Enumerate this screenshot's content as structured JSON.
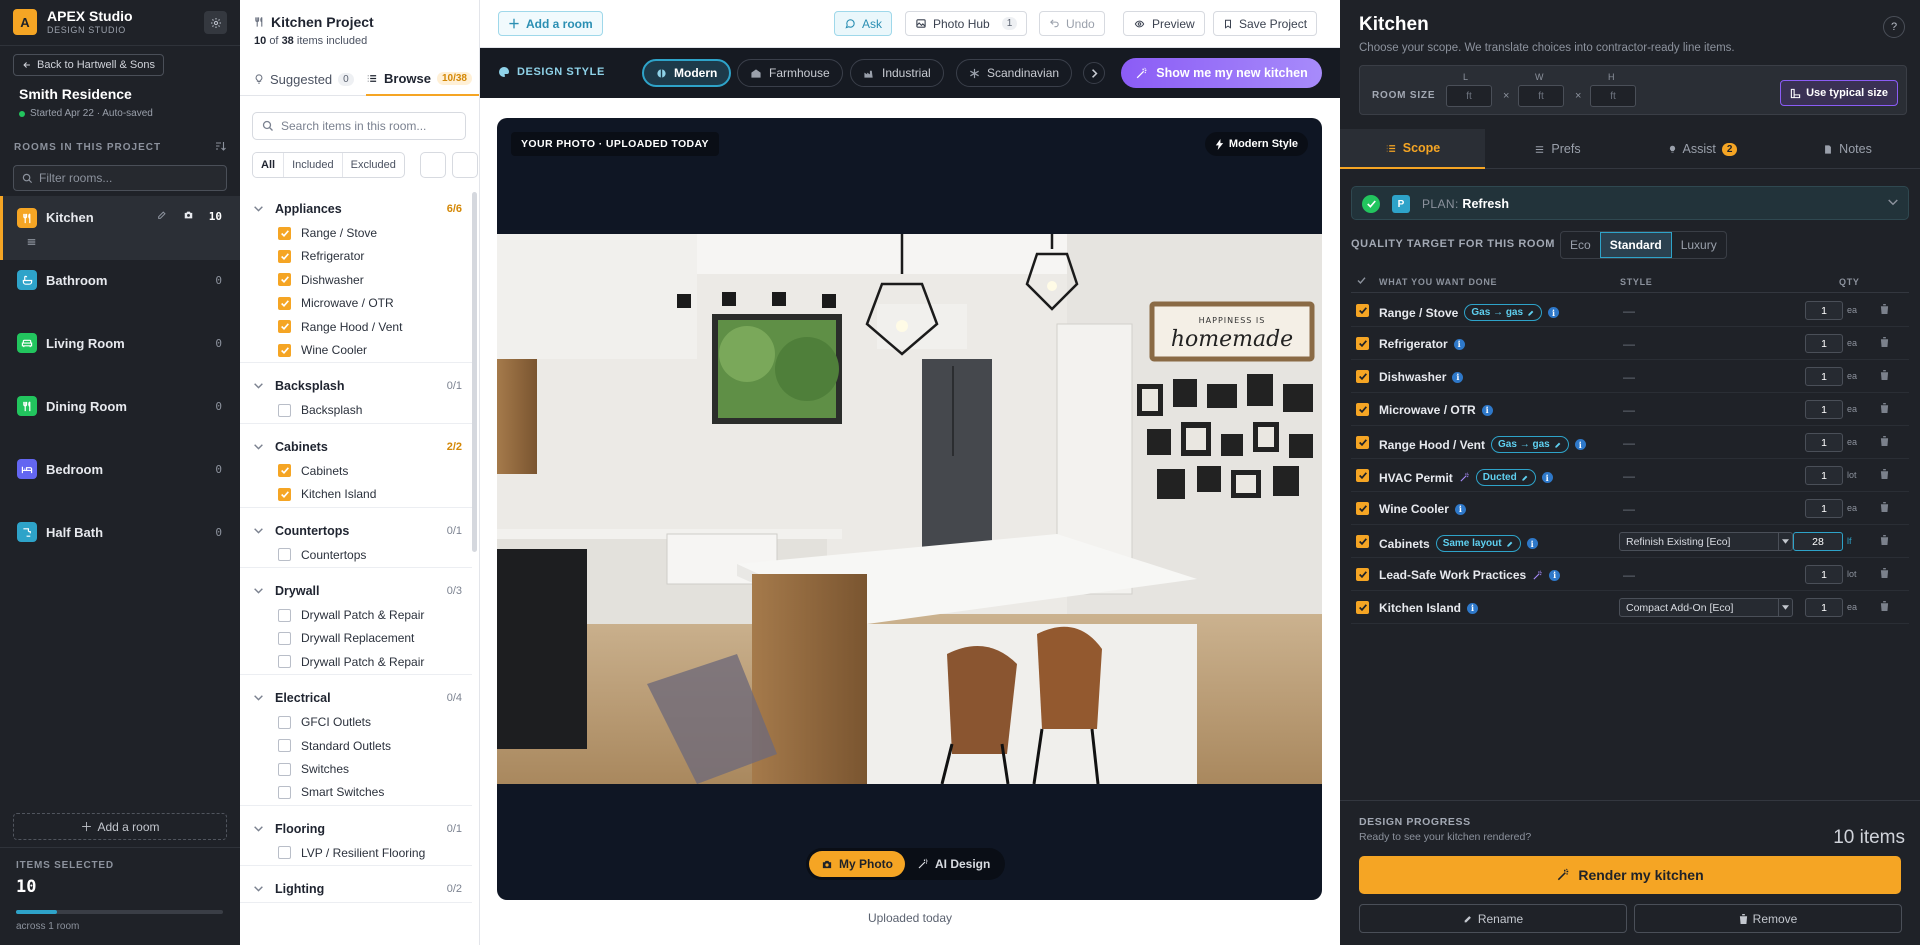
{
  "app": {
    "logo_letter": "A",
    "name": "APEX Studio",
    "subtitle": "DESIGN STUDIO"
  },
  "sidebar": {
    "back_label": "Back to Hartwell & Sons",
    "project_name": "Smith Residence",
    "project_meta": "Started Apr 22 · Auto-saved",
    "rooms_heading": "ROOMS IN THIS PROJECT",
    "filter_placeholder": "Filter rooms...",
    "rooms": [
      {
        "label": "Kitchen",
        "count": "10",
        "color": "#f5a524"
      },
      {
        "label": "Bathroom",
        "count": "0",
        "color": "#2ea3c9"
      },
      {
        "label": "Living Room",
        "count": "0",
        "color": "#22c55e"
      },
      {
        "label": "Dining Room",
        "count": "0",
        "color": "#22c55e"
      },
      {
        "label": "Bedroom",
        "count": "0",
        "color": "#6366f1"
      },
      {
        "label": "Half Bath",
        "count": "0",
        "color": "#2ea3c9"
      }
    ],
    "add_room": "Add a room",
    "items_selected_label": "ITEMS SELECTED",
    "items_selected_count": "10",
    "items_selected_fraction": 0.2,
    "items_selected_sub": "across 1 room"
  },
  "browse": {
    "title": "Kitchen Project",
    "included_count": "10",
    "of_word": "of",
    "total_count": "38",
    "included_suffix": "items included",
    "tab_suggested": "Suggested",
    "tab_suggested_count": "0",
    "tab_browse": "Browse",
    "tab_browse_count": "10/38",
    "search_placeholder": "Search items in this room...",
    "filter_all": "All",
    "filter_included": "Included",
    "filter_excluded": "Excluded",
    "categories": [
      {
        "name": "Appliances",
        "count": "6/6",
        "items": [
          {
            "label": "Range / Stove",
            "checked": true
          },
          {
            "label": "Refrigerator",
            "checked": true
          },
          {
            "label": "Dishwasher",
            "checked": true
          },
          {
            "label": "Microwave / OTR",
            "checked": true
          },
          {
            "label": "Range Hood / Vent",
            "checked": true
          },
          {
            "label": "Wine Cooler",
            "checked": true
          }
        ]
      },
      {
        "name": "Backsplash",
        "count": "0/1",
        "items": [
          {
            "label": "Backsplash",
            "checked": false
          }
        ]
      },
      {
        "name": "Cabinets",
        "count": "2/2",
        "items": [
          {
            "label": "Cabinets",
            "checked": true
          },
          {
            "label": "Kitchen Island",
            "checked": true
          }
        ]
      },
      {
        "name": "Countertops",
        "count": "0/1",
        "items": [
          {
            "label": "Countertops",
            "checked": false
          }
        ]
      },
      {
        "name": "Drywall",
        "count": "0/3",
        "items": [
          {
            "label": "Drywall Patch & Repair",
            "checked": false
          },
          {
            "label": "Drywall Replacement",
            "checked": false
          },
          {
            "label": "Drywall Patch & Repair",
            "checked": false
          }
        ]
      },
      {
        "name": "Electrical",
        "count": "0/4",
        "items": [
          {
            "label": "GFCI Outlets",
            "checked": false
          },
          {
            "label": "Standard Outlets",
            "checked": false
          },
          {
            "label": "Switches",
            "checked": false
          },
          {
            "label": "Smart Switches",
            "checked": false
          }
        ]
      },
      {
        "name": "Flooring",
        "count": "0/1",
        "items": [
          {
            "label": "LVP / Resilient Flooring",
            "checked": false
          }
        ]
      },
      {
        "name": "Lighting",
        "count": "0/2",
        "items": []
      }
    ]
  },
  "toolbar": {
    "add_room": "Add a room",
    "ask": "Ask",
    "photo_hub": "Photo Hub",
    "photo_hub_count": "1",
    "undo": "Undo",
    "preview": "Preview",
    "save": "Save Project"
  },
  "design_style": {
    "label": "DESIGN STYLE",
    "styles": [
      "Modern",
      "Farmhouse",
      "Industrial",
      "Scandinavian"
    ],
    "active": "Modern",
    "cta": "Show me my new kitchen"
  },
  "photo": {
    "tag": "YOUR PHOTO · UPLOADED TODAY",
    "style_tag": "Modern Style",
    "sign_line1": "HAPPINESS IS",
    "sign_line2": "homemade",
    "toggle_my_photo": "My Photo",
    "toggle_ai": "AI Design",
    "caption": "Uploaded today"
  },
  "right": {
    "title": "Kitchen",
    "subtitle": "Choose your scope. We translate choices into contractor-ready line items.",
    "room_size_label": "ROOM SIZE",
    "dims": [
      {
        "cap": "L",
        "unit": "ft"
      },
      {
        "cap": "W",
        "unit": "ft"
      },
      {
        "cap": "H",
        "unit": "ft"
      }
    ],
    "times": "×",
    "typical_btn": "Use typical size",
    "tabs": {
      "scope": "Scope",
      "prefs": "Prefs",
      "assist": "Assist",
      "assist_count": "2",
      "notes": "Notes"
    },
    "plan_prefix": "PLAN:",
    "plan_value": "Refresh",
    "plan_letter": "P",
    "quality_label": "QUALITY TARGET FOR THIS ROOM",
    "quality_options": [
      "Eco",
      "Standard",
      "Luxury"
    ],
    "quality_active": "Standard",
    "col_what": "WHAT YOU WANT DONE",
    "col_style": "STYLE",
    "col_qty": "QTY",
    "rows": [
      {
        "name": "Range / Stove",
        "pill": "Gas → gas",
        "wand": false,
        "style": "—",
        "qty": "1",
        "unit": "ea"
      },
      {
        "name": "Refrigerator",
        "pill": "",
        "wand": false,
        "style": "—",
        "qty": "1",
        "unit": "ea"
      },
      {
        "name": "Dishwasher",
        "pill": "",
        "wand": false,
        "style": "—",
        "qty": "1",
        "unit": "ea"
      },
      {
        "name": "Microwave / OTR",
        "pill": "",
        "wand": false,
        "style": "—",
        "qty": "1",
        "unit": "ea"
      },
      {
        "name": "Range Hood / Vent",
        "pill": "Gas → gas",
        "wand": false,
        "style": "—",
        "qty": "1",
        "unit": "ea"
      },
      {
        "name": "HVAC Permit",
        "pill": "Ducted",
        "wand": true,
        "style": "—",
        "qty": "1",
        "unit": "lot"
      },
      {
        "name": "Wine Cooler",
        "pill": "",
        "wand": false,
        "style": "—",
        "qty": "1",
        "unit": "ea"
      },
      {
        "name": "Cabinets",
        "pill": "Same layout",
        "wand": false,
        "style_select": "Refinish Existing [Eco]",
        "qty": "28",
        "unit": "lf"
      },
      {
        "name": "Lead-Safe Work Practices",
        "pill": "",
        "wand": true,
        "style": "—",
        "qty": "1",
        "unit": "lot"
      },
      {
        "name": "Kitchen Island",
        "pill": "",
        "wand": false,
        "style_select": "Compact Add-On [Eco]",
        "qty": "1",
        "unit": "ea"
      }
    ],
    "progress_label": "DESIGN PROGRESS",
    "progress_sub": "Ready to see your kitchen rendered?",
    "progress_count": "10 items",
    "render_btn": "Render my kitchen",
    "rename": "Rename",
    "remove": "Remove"
  },
  "colors": {
    "accent": "#f5a524",
    "teal": "#2ea3c9",
    "violet": "#8b5cf6",
    "dark": "#1f2228"
  }
}
